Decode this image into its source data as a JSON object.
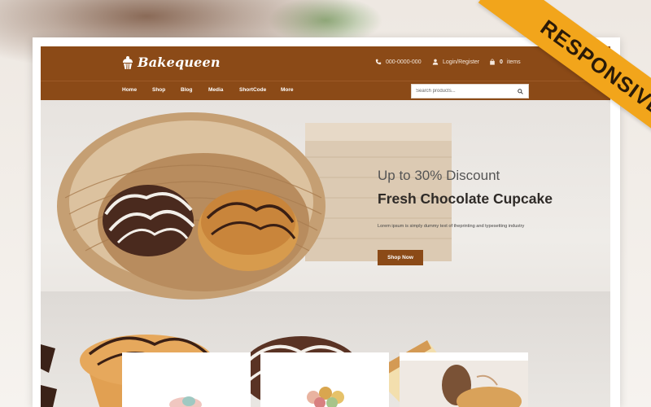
{
  "brand": {
    "name": "Bakequeen"
  },
  "header": {
    "phone": "000-0000-000",
    "login": "Login/Register",
    "cart": {
      "count": "0",
      "label": "items"
    }
  },
  "nav": {
    "items": [
      "Home",
      "Shop",
      "Blog",
      "Media",
      "ShortCode",
      "More"
    ]
  },
  "search": {
    "placeholder": "Search products..."
  },
  "hero": {
    "subtitle": "Up to 30% Discount",
    "title": "Fresh Chocolate Cupcake",
    "description": "Lorem ipsum is simply dummy text of theprinting and typesetting industry",
    "button": "Shop Now"
  },
  "ribbon": {
    "label": "RESPONSIVE"
  },
  "colors": {
    "brand": "#8b4a17",
    "ribbon": "#f2a51b"
  },
  "icons": [
    "cupcake-icon",
    "phone-icon",
    "user-icon",
    "bag-icon",
    "search-icon"
  ]
}
